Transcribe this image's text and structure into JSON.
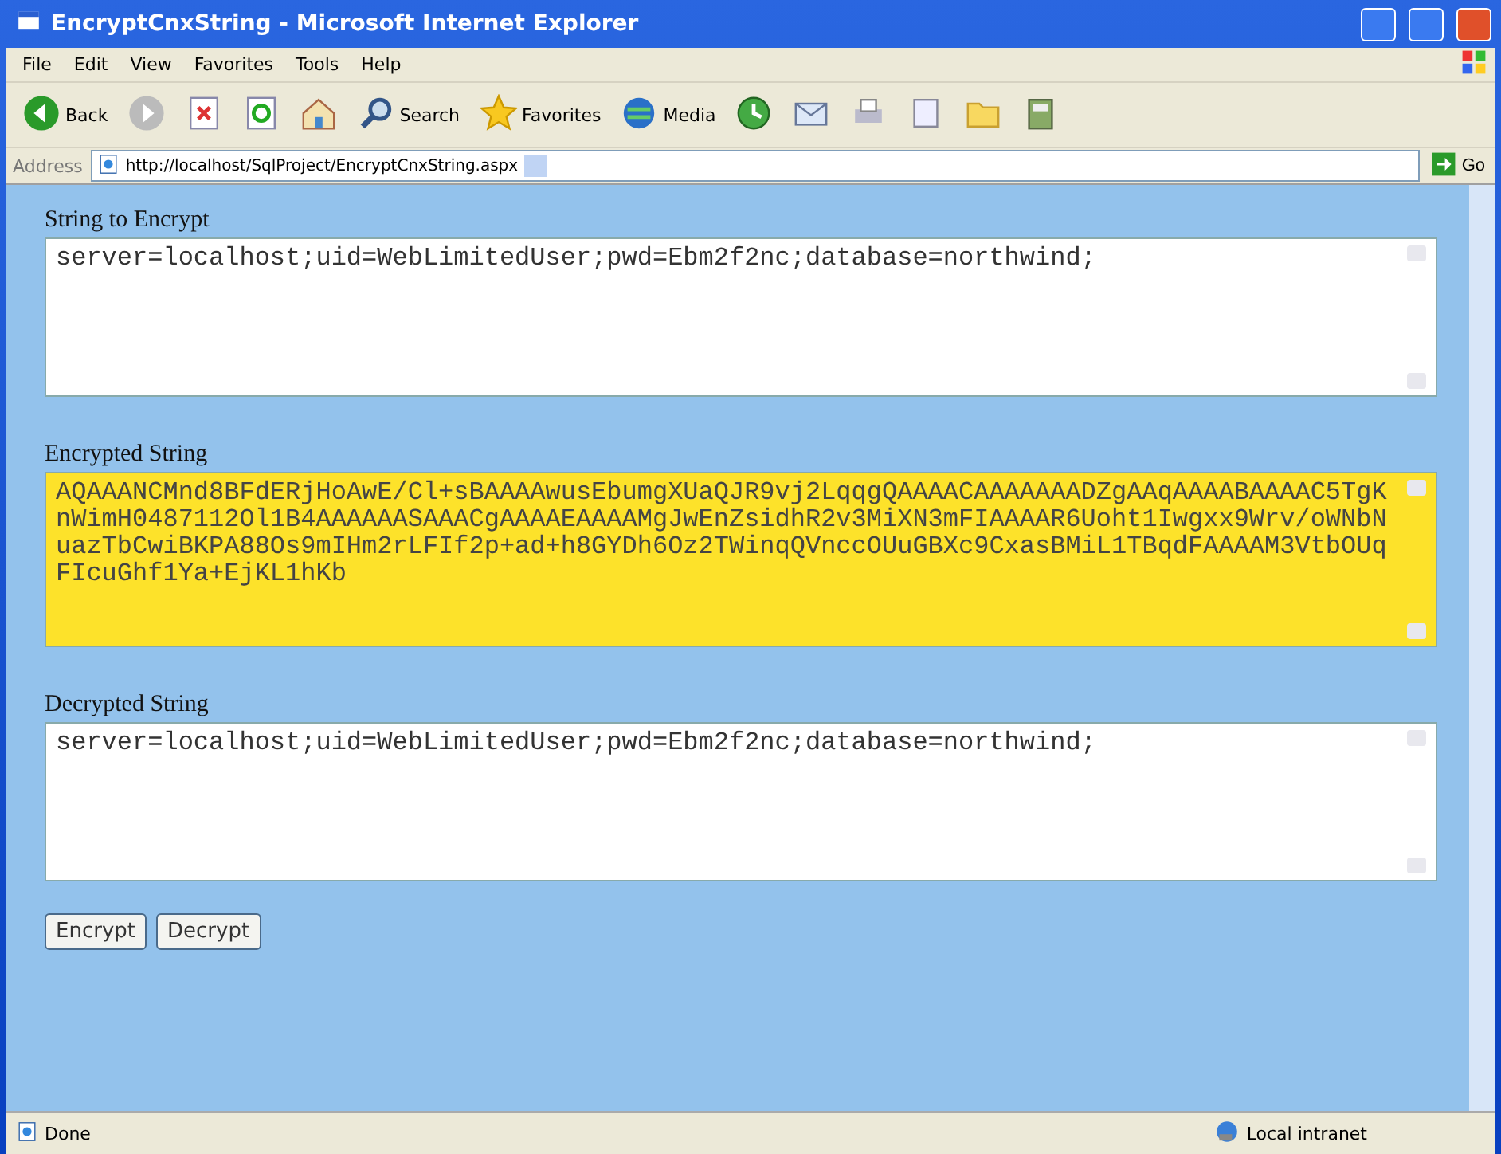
{
  "window": {
    "title": "EncryptCnxString - Microsoft Internet Explorer"
  },
  "menu": [
    "File",
    "Edit",
    "View",
    "Favorites",
    "Tools",
    "Help"
  ],
  "toolbar": [
    {
      "kind": "back",
      "label": "Back"
    },
    {
      "kind": "forward"
    },
    {
      "kind": "stop"
    },
    {
      "kind": "refresh"
    },
    {
      "kind": "home"
    },
    {
      "kind": "search",
      "label": "Search"
    },
    {
      "kind": "favorites",
      "label": "Favorites"
    },
    {
      "kind": "media",
      "label": "Media"
    },
    {
      "kind": "history"
    },
    {
      "kind": "mail"
    },
    {
      "kind": "print"
    },
    {
      "kind": "edit"
    },
    {
      "kind": "folder"
    },
    {
      "kind": "research"
    }
  ],
  "address": {
    "label": "Address",
    "value": "http://localhost/SqlProject/EncryptCnxString.aspx",
    "go": "Go"
  },
  "fields": [
    {
      "label": "String to Encrypt",
      "value": "server=localhost;uid=WebLimitedUser;pwd=Ebm2f2nc;database=northwind;",
      "highlighted": false
    },
    {
      "label": "Encrypted String",
      "value": "AQAAANCMnd8BFdERjHoAwE/Cl+sBAAAAwusEbumgXUaQJR9vj2LqqgQAAAACAAAAAAADZgAAqAAAABAAAAC5TgKnWimH0487112Ol1B4AAAAAASAAACgAAAAEAAAAMgJwEnZsidhR2v3MiXN3mFIAAAAR6Uoht1Iwgxx9Wrv/oWNbNuazTbCwiBKPA88Os9mIHm2rLFIf2p+ad+h8GYDh6Oz2TWinqQVnccOUuGBXc9CxasBMiL1TBqdFAAAAM3VtbOUqFIcuGhf1Ya+EjKL1hKb",
      "highlighted": true
    },
    {
      "label": "Decrypted String",
      "value": "server=localhost;uid=WebLimitedUser;pwd=Ebm2f2nc;database=northwind;",
      "highlighted": false
    }
  ],
  "buttons": [
    "Encrypt",
    "Decrypt"
  ],
  "status_bar": {
    "status": "Done",
    "zone": "Local intranet"
  }
}
